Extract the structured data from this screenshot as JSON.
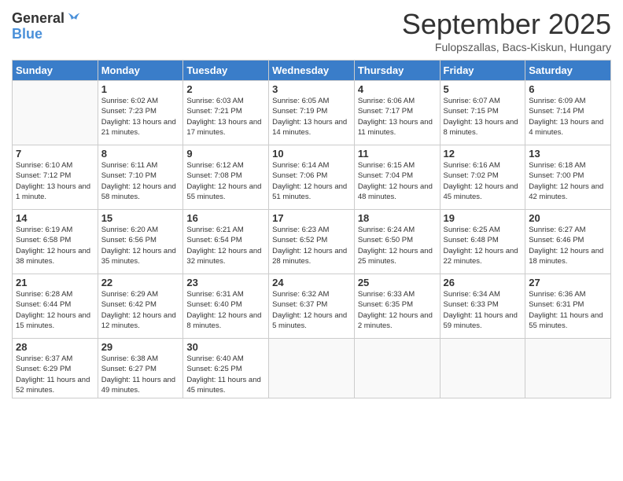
{
  "logo": {
    "line1": "General",
    "line2": "Blue"
  },
  "header": {
    "title": "September 2025",
    "location": "Fulopszallas, Bacs-Kiskun, Hungary"
  },
  "weekdays": [
    "Sunday",
    "Monday",
    "Tuesday",
    "Wednesday",
    "Thursday",
    "Friday",
    "Saturday"
  ],
  "weeks": [
    [
      {
        "day": "",
        "info": ""
      },
      {
        "day": "1",
        "info": "Sunrise: 6:02 AM\nSunset: 7:23 PM\nDaylight: 13 hours\nand 21 minutes."
      },
      {
        "day": "2",
        "info": "Sunrise: 6:03 AM\nSunset: 7:21 PM\nDaylight: 13 hours\nand 17 minutes."
      },
      {
        "day": "3",
        "info": "Sunrise: 6:05 AM\nSunset: 7:19 PM\nDaylight: 13 hours\nand 14 minutes."
      },
      {
        "day": "4",
        "info": "Sunrise: 6:06 AM\nSunset: 7:17 PM\nDaylight: 13 hours\nand 11 minutes."
      },
      {
        "day": "5",
        "info": "Sunrise: 6:07 AM\nSunset: 7:15 PM\nDaylight: 13 hours\nand 8 minutes."
      },
      {
        "day": "6",
        "info": "Sunrise: 6:09 AM\nSunset: 7:14 PM\nDaylight: 13 hours\nand 4 minutes."
      }
    ],
    [
      {
        "day": "7",
        "info": "Sunrise: 6:10 AM\nSunset: 7:12 PM\nDaylight: 13 hours\nand 1 minute."
      },
      {
        "day": "8",
        "info": "Sunrise: 6:11 AM\nSunset: 7:10 PM\nDaylight: 12 hours\nand 58 minutes."
      },
      {
        "day": "9",
        "info": "Sunrise: 6:12 AM\nSunset: 7:08 PM\nDaylight: 12 hours\nand 55 minutes."
      },
      {
        "day": "10",
        "info": "Sunrise: 6:14 AM\nSunset: 7:06 PM\nDaylight: 12 hours\nand 51 minutes."
      },
      {
        "day": "11",
        "info": "Sunrise: 6:15 AM\nSunset: 7:04 PM\nDaylight: 12 hours\nand 48 minutes."
      },
      {
        "day": "12",
        "info": "Sunrise: 6:16 AM\nSunset: 7:02 PM\nDaylight: 12 hours\nand 45 minutes."
      },
      {
        "day": "13",
        "info": "Sunrise: 6:18 AM\nSunset: 7:00 PM\nDaylight: 12 hours\nand 42 minutes."
      }
    ],
    [
      {
        "day": "14",
        "info": "Sunrise: 6:19 AM\nSunset: 6:58 PM\nDaylight: 12 hours\nand 38 minutes."
      },
      {
        "day": "15",
        "info": "Sunrise: 6:20 AM\nSunset: 6:56 PM\nDaylight: 12 hours\nand 35 minutes."
      },
      {
        "day": "16",
        "info": "Sunrise: 6:21 AM\nSunset: 6:54 PM\nDaylight: 12 hours\nand 32 minutes."
      },
      {
        "day": "17",
        "info": "Sunrise: 6:23 AM\nSunset: 6:52 PM\nDaylight: 12 hours\nand 28 minutes."
      },
      {
        "day": "18",
        "info": "Sunrise: 6:24 AM\nSunset: 6:50 PM\nDaylight: 12 hours\nand 25 minutes."
      },
      {
        "day": "19",
        "info": "Sunrise: 6:25 AM\nSunset: 6:48 PM\nDaylight: 12 hours\nand 22 minutes."
      },
      {
        "day": "20",
        "info": "Sunrise: 6:27 AM\nSunset: 6:46 PM\nDaylight: 12 hours\nand 18 minutes."
      }
    ],
    [
      {
        "day": "21",
        "info": "Sunrise: 6:28 AM\nSunset: 6:44 PM\nDaylight: 12 hours\nand 15 minutes."
      },
      {
        "day": "22",
        "info": "Sunrise: 6:29 AM\nSunset: 6:42 PM\nDaylight: 12 hours\nand 12 minutes."
      },
      {
        "day": "23",
        "info": "Sunrise: 6:31 AM\nSunset: 6:40 PM\nDaylight: 12 hours\nand 8 minutes."
      },
      {
        "day": "24",
        "info": "Sunrise: 6:32 AM\nSunset: 6:37 PM\nDaylight: 12 hours\nand 5 minutes."
      },
      {
        "day": "25",
        "info": "Sunrise: 6:33 AM\nSunset: 6:35 PM\nDaylight: 12 hours\nand 2 minutes."
      },
      {
        "day": "26",
        "info": "Sunrise: 6:34 AM\nSunset: 6:33 PM\nDaylight: 11 hours\nand 59 minutes."
      },
      {
        "day": "27",
        "info": "Sunrise: 6:36 AM\nSunset: 6:31 PM\nDaylight: 11 hours\nand 55 minutes."
      }
    ],
    [
      {
        "day": "28",
        "info": "Sunrise: 6:37 AM\nSunset: 6:29 PM\nDaylight: 11 hours\nand 52 minutes."
      },
      {
        "day": "29",
        "info": "Sunrise: 6:38 AM\nSunset: 6:27 PM\nDaylight: 11 hours\nand 49 minutes."
      },
      {
        "day": "30",
        "info": "Sunrise: 6:40 AM\nSunset: 6:25 PM\nDaylight: 11 hours\nand 45 minutes."
      },
      {
        "day": "",
        "info": ""
      },
      {
        "day": "",
        "info": ""
      },
      {
        "day": "",
        "info": ""
      },
      {
        "day": "",
        "info": ""
      }
    ]
  ]
}
